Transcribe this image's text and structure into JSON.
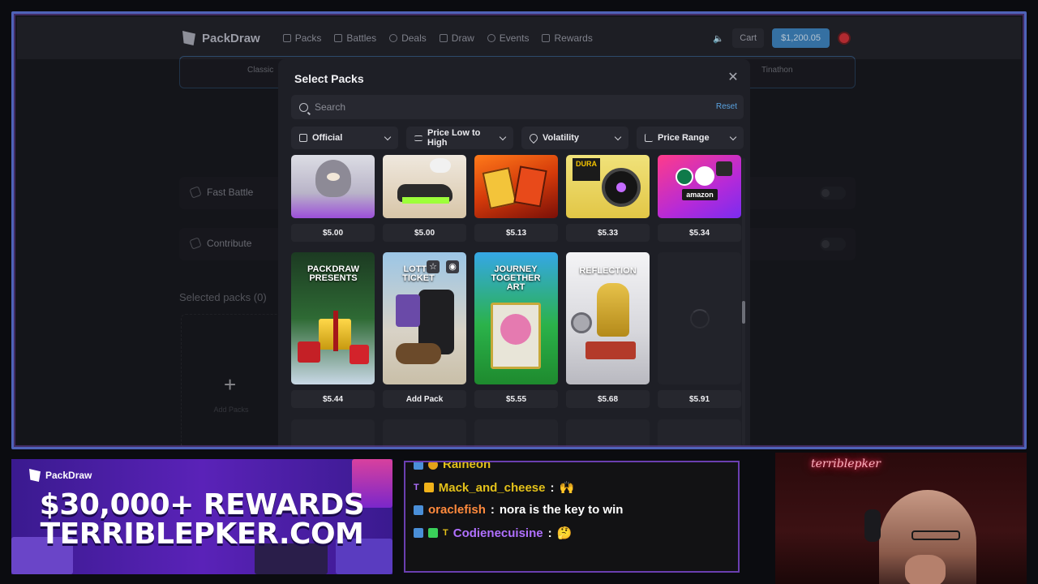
{
  "site": {
    "brand": "PackDraw",
    "nav": [
      "Packs",
      "Battles",
      "Deals",
      "Draw",
      "Events",
      "Rewards"
    ],
    "cart_label": "Cart",
    "balance": "$1,200.05",
    "bg": {
      "tab_left": "Classic",
      "tab_right": "Tinathon",
      "fast_battle": "Fast Battle",
      "contribute": "Contribute",
      "selected_packs": "Selected packs (0)",
      "add_packs": "Add Packs"
    }
  },
  "modal": {
    "title": "Select Packs",
    "search_placeholder": "Search",
    "reset_label": "Reset",
    "filters": [
      {
        "label": "Official",
        "icon": "box-icon"
      },
      {
        "label": "Price Low to High",
        "icon": "sort-icon"
      },
      {
        "label": "Volatility",
        "icon": "flame-icon"
      },
      {
        "label": "Price Range",
        "icon": "trend-icon"
      }
    ],
    "row1": [
      {
        "price": "$5.00",
        "theme": "toy"
      },
      {
        "price": "$5.00",
        "theme": "sneaker"
      },
      {
        "price": "$5.13",
        "theme": "fire"
      },
      {
        "price": "$5.33",
        "theme": "tech"
      },
      {
        "price": "$5.34",
        "theme": "giftcard",
        "text": "amazon"
      }
    ],
    "row2": [
      {
        "price": "$5.44",
        "title": "PACKDRAW PRESENTS",
        "theme": "christmas"
      },
      {
        "price": "Add Pack",
        "title": "LOTTO TICKET",
        "theme": "lotto"
      },
      {
        "price": "$5.55",
        "title": "JOURNEY TOGETHER ART",
        "theme": "journey"
      },
      {
        "price": "$5.68",
        "title": "REFLECTION",
        "theme": "reflection"
      },
      {
        "price": "$5.91",
        "title": "",
        "theme": "loading"
      }
    ]
  },
  "promo": {
    "brand": "PackDraw",
    "headline1": "$30,000+ REWARDS",
    "headline2": "TERRIBLEPKER.COM"
  },
  "chat": {
    "messages": [
      {
        "user": "Raineon",
        "text": "",
        "color": "#e3c11a"
      },
      {
        "user": "Mack_and_cheese",
        "text": "🙌",
        "color": "#e3c11a"
      },
      {
        "user": "oraclefish",
        "text": "nora is the key to win",
        "color": "#ff8a3d"
      },
      {
        "user": "Codienecuisine",
        "text": "🤔",
        "color": "#b070ff"
      }
    ]
  },
  "webcam": {
    "neon_sign": "terriblepker"
  }
}
